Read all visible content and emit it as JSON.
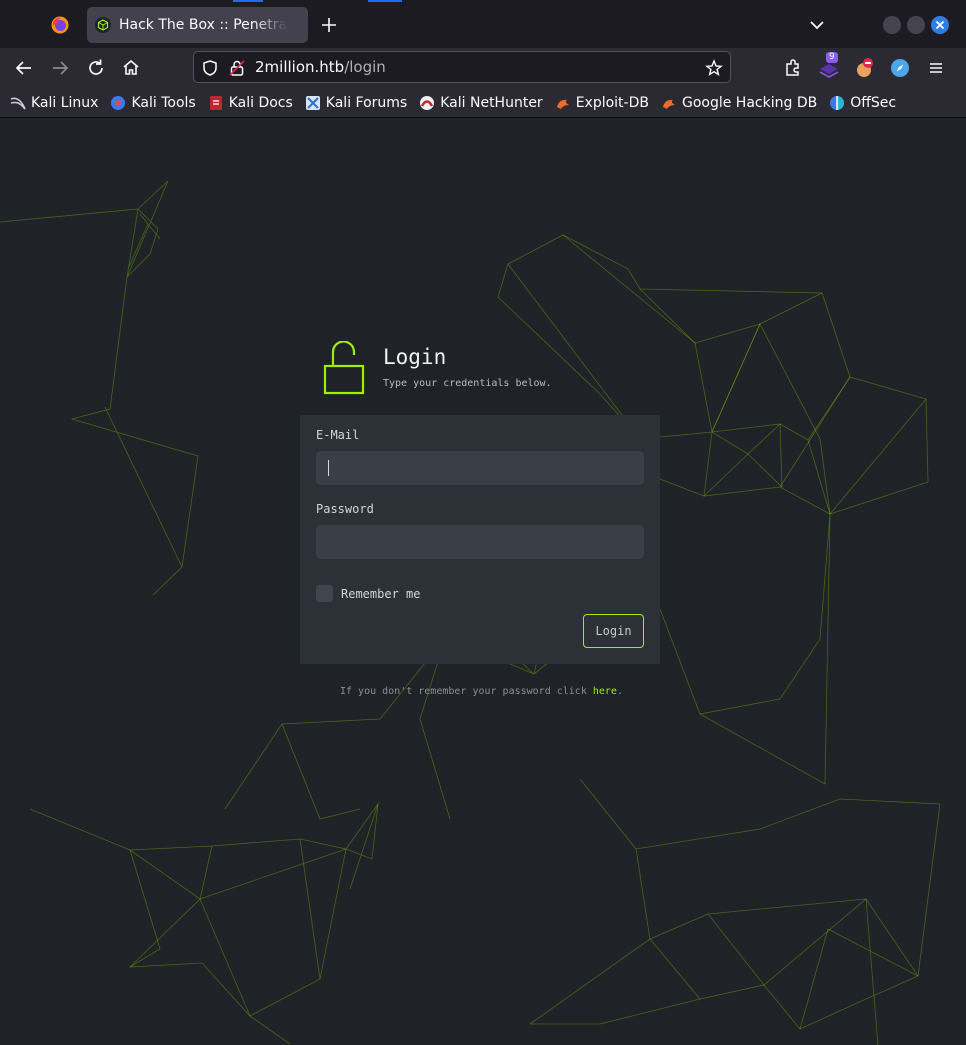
{
  "browser": {
    "tab": {
      "title": "Hack The Box :: Penetration Testing Labs"
    },
    "url": {
      "host": "2million.htb",
      "path": "/login"
    },
    "extensions": {
      "badge_count": "9"
    },
    "bookmarks": [
      {
        "label": "Kali Linux",
        "icon": "kali-dragon-icon"
      },
      {
        "label": "Kali Tools",
        "icon": "kali-tools-icon"
      },
      {
        "label": "Kali Docs",
        "icon": "kali-docs-icon"
      },
      {
        "label": "Kali Forums",
        "icon": "kali-forums-icon"
      },
      {
        "label": "Kali NetHunter",
        "icon": "nethunter-icon"
      },
      {
        "label": "Exploit-DB",
        "icon": "exploit-db-icon"
      },
      {
        "label": "Google Hacking DB",
        "icon": "ghdb-icon"
      },
      {
        "label": "OffSec",
        "icon": "offsec-icon"
      }
    ]
  },
  "login": {
    "title": "Login",
    "subtitle": "Type your credentials below.",
    "email_label": "E-Mail",
    "email_value": "",
    "password_label": "Password",
    "password_value": "",
    "remember_label": "Remember me",
    "submit_label": "Login",
    "forgot_prefix": "If you don't remember your password click ",
    "forgot_link": "here",
    "forgot_suffix": "."
  },
  "colors": {
    "accent": "#9fef00",
    "background": "#1f2227",
    "card": "#2c3037",
    "browser_blue": "#2f7de1"
  }
}
